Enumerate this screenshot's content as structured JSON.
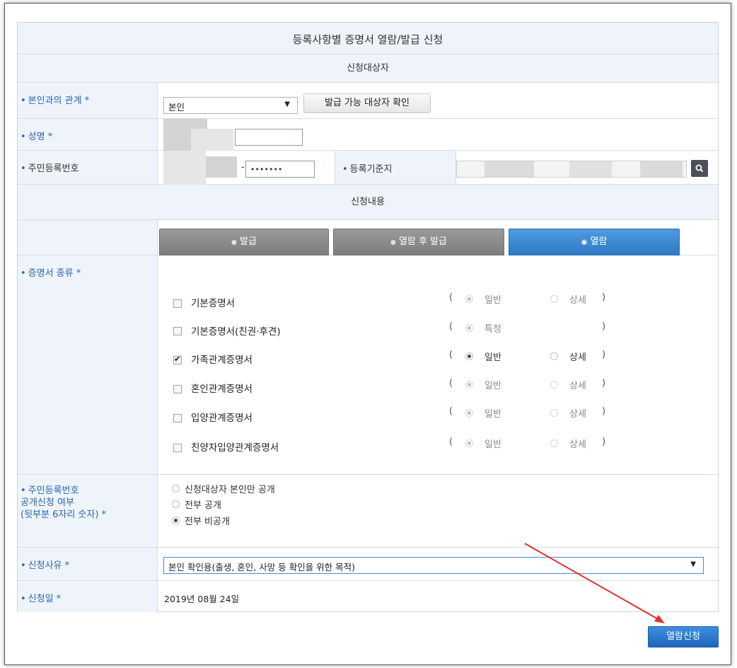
{
  "form": {
    "title": "등록사항별 증명서 열람/발급 신청",
    "section_applicant": "신청대상자",
    "section_content": "신청내용"
  },
  "relation": {
    "label": "본인과의 관계 *",
    "selected": "본인",
    "check_button": "발급 가능 대상자 확인"
  },
  "name": {
    "label": "성명 *"
  },
  "rrn": {
    "label": "주민등록번호",
    "dash": "-",
    "masked": "•••••••"
  },
  "registry": {
    "label": "등록기준지"
  },
  "tabs": [
    {
      "label": "발급",
      "active": false
    },
    {
      "label": "열람 후 발급",
      "active": false
    },
    {
      "label": "열람",
      "active": true
    }
  ],
  "certificates": {
    "label": "증명서 종류 *",
    "items": [
      {
        "name": "기본증명서",
        "checked": false,
        "opt1": "일반",
        "opt2": "상세"
      },
      {
        "name": "기본증명서(친권·후견)",
        "checked": false,
        "opt1": "특정",
        "opt2": ""
      },
      {
        "name": "가족관계증명서",
        "checked": true,
        "opt1": "일반",
        "opt2": "상세"
      },
      {
        "name": "혼인관계증명서",
        "checked": false,
        "opt1": "일반",
        "opt2": "상세"
      },
      {
        "name": "입양관계증명서",
        "checked": false,
        "opt1": "일반",
        "opt2": "상세"
      },
      {
        "name": "친양자입양관계증명서",
        "checked": false,
        "opt1": "일반",
        "opt2": "상세"
      }
    ],
    "open_paren": "(",
    "close_paren": ")"
  },
  "disclosure": {
    "label_line1": "주민등록번호",
    "label_line2": "공개신청 여부",
    "label_line3": "(뒷부분 6자리 숫자) *",
    "options": [
      "신청대상자 본인만 공개",
      "전부 공개",
      "전부 비공개"
    ],
    "selected_index": 2
  },
  "reason": {
    "label": "신청사유 *",
    "selected": "본인 확인용(출생, 혼인, 사망 등 확인을 위한 목적)"
  },
  "date": {
    "label": "신청일 *",
    "value": "2019년 08월 24일"
  },
  "submit_label": "열람신청",
  "colors": {
    "label_blue": "#2a66b4",
    "tab_active": "#2f78c4",
    "tab_inactive": "#8a8a8a",
    "arrow": "#e03030"
  }
}
